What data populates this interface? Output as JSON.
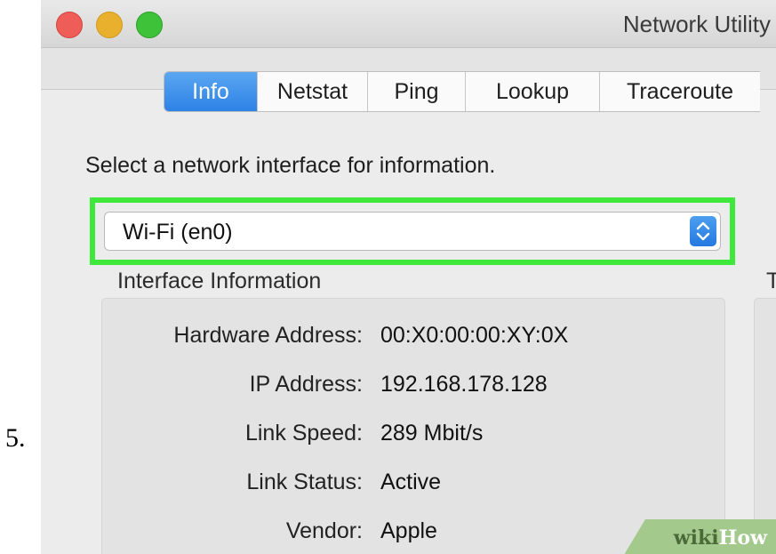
{
  "step_number": "5.",
  "window": {
    "title": "Network Utility"
  },
  "tabs": [
    {
      "label": "Info",
      "active": true
    },
    {
      "label": "Netstat",
      "active": false
    },
    {
      "label": "Ping",
      "active": false
    },
    {
      "label": "Lookup",
      "active": false
    },
    {
      "label": "Traceroute",
      "active": false
    }
  ],
  "instruction": "Select a network interface for information.",
  "interface_select": {
    "value": "Wi-Fi (en0)",
    "highlight_color": "#3fe83a"
  },
  "interface_info": {
    "title": "Interface Information",
    "rows": [
      {
        "label": "Hardware Address:",
        "value": "00:X0:00:00:XY:0X"
      },
      {
        "label": "IP Address:",
        "value": "192.168.178.128"
      },
      {
        "label": "Link Speed:",
        "value": "289 Mbit/s"
      },
      {
        "label": "Link Status:",
        "value": "Active"
      },
      {
        "label": "Vendor:",
        "value": "Apple"
      }
    ]
  },
  "right_panel_title_fragment": "T",
  "watermark": {
    "part1": "wiki",
    "part2": "How"
  },
  "colors": {
    "tab_active": "#2d82e6",
    "window_bg": "#ececec",
    "traffic_red": "#ee5d57",
    "traffic_yellow": "#e8b02d",
    "traffic_green": "#3ec23a"
  }
}
